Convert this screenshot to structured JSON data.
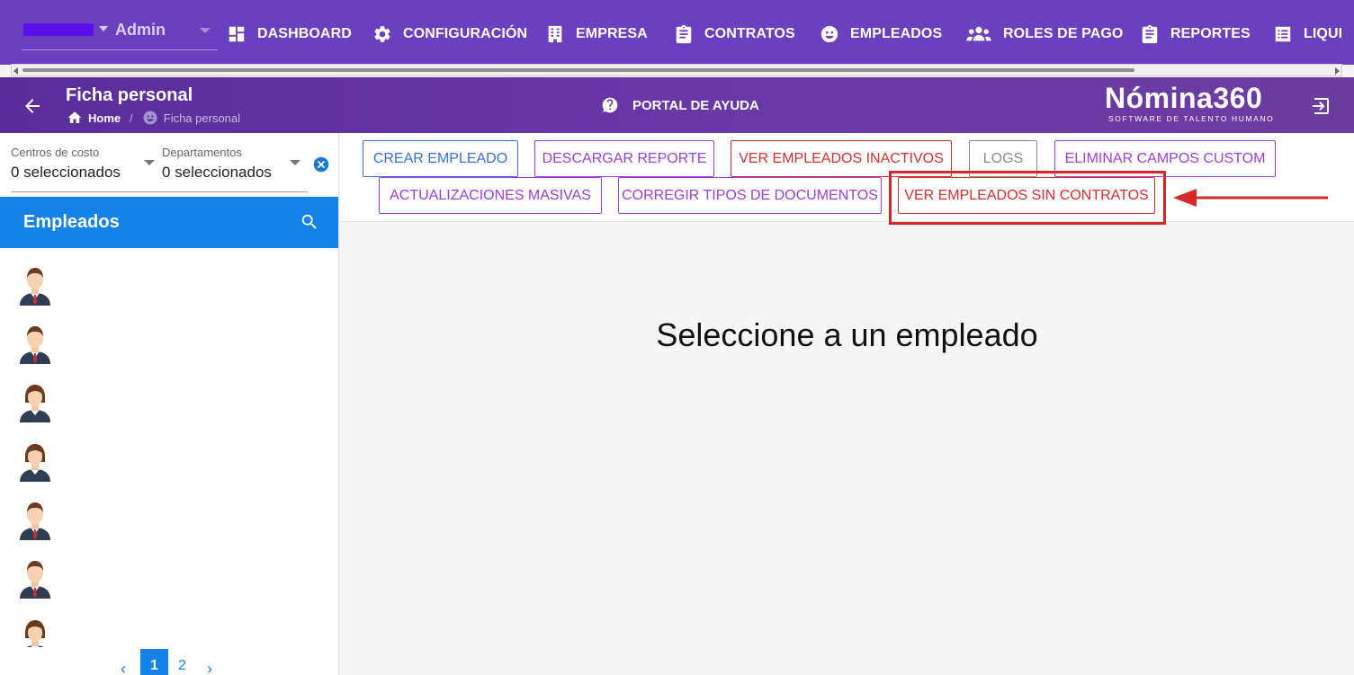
{
  "topnav": {
    "company_name": "Admin",
    "items": [
      {
        "label": "DASHBOARD"
      },
      {
        "label": "CONFIGURACIÓN"
      },
      {
        "label": "EMPRESA"
      },
      {
        "label": "CONTRATOS"
      },
      {
        "label": "EMPLEADOS"
      },
      {
        "label": "ROLES DE PAGO"
      },
      {
        "label": "REPORTES"
      },
      {
        "label": "LIQUI"
      }
    ]
  },
  "header": {
    "title": "Ficha personal",
    "breadcrumb_home": "Home",
    "breadcrumb_sep": "/",
    "breadcrumb_current": "Ficha personal",
    "help_label": "PORTAL DE AYUDA",
    "logo_main": "Nómina360",
    "logo_sub": "SOFTWARE DE TALENTO HUMANO"
  },
  "sidebar": {
    "filters": [
      {
        "label": "Centros de costo",
        "value": "0 seleccionados"
      },
      {
        "label": "Departamentos",
        "value": "0 seleccionados"
      }
    ],
    "employees_title": "Empleados",
    "pagination": {
      "prev": "‹",
      "pages": [
        "1",
        "2"
      ],
      "current": "1",
      "next": "›"
    }
  },
  "toolbar": {
    "buttons": [
      {
        "label": "CREAR EMPLEADO",
        "color": "#3b6fd4"
      },
      {
        "label": "DESCARGAR REPORTE",
        "color": "#9b3fd6"
      },
      {
        "label": "VER EMPLEADOS INACTIVOS",
        "color": "#d32f2f"
      },
      {
        "label": "LOGS",
        "color": "#8a8a8a"
      },
      {
        "label": "ELIMINAR CAMPOS CUSTOM",
        "color": "#9b3fd6"
      },
      {
        "label": "ACTUALIZACIONES MASIVAS",
        "color": "#9b3fd6"
      },
      {
        "label": "CORREGIR TIPOS DE DOCUMENTOS",
        "color": "#9b3fd6"
      },
      {
        "label": "VER EMPLEADOS SIN CONTRATOS",
        "color": "#d32f2f"
      }
    ]
  },
  "main": {
    "empty_message": "Seleccione a un empleado"
  },
  "colors": {
    "nav_bg": "#6a3fc0",
    "accent_blue": "#1582e8",
    "annotation_red": "#d6282a"
  }
}
